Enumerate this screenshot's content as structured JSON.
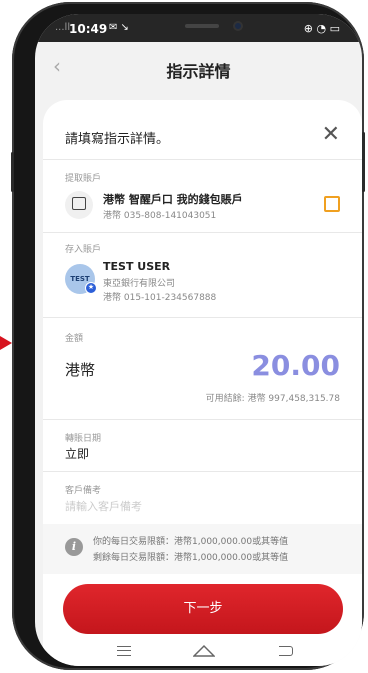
{
  "status_bar": {
    "time": "10:49",
    "left_signal": "...ll"
  },
  "nav": {
    "title": "指示詳情"
  },
  "sheet": {
    "instruction": "請填寫指示詳情。"
  },
  "from_account": {
    "label": "提取賬戶",
    "name": "港幣 智醒戶口 我的錢包賬戶",
    "number": "港幣 035-808-141043051"
  },
  "to_account": {
    "label": "存入賬戶",
    "avatar_text": "TEST",
    "name": "TEST USER",
    "bank": "東亞銀行有限公司",
    "number": "港幣 015-101-234567888"
  },
  "amount": {
    "label": "金額",
    "currency": "港幣",
    "value": "20.00",
    "available": "可用結餘: 港幣 997,458,315.78"
  },
  "transfer_date": {
    "label": "轉賬日期",
    "value": "立即"
  },
  "remark": {
    "label": "客戶備考",
    "placeholder": "請輸入客戶備考"
  },
  "limits": {
    "daily_limit": "你的每日交易限額：港幣1,000,000.00或其等值",
    "remaining_limit": "剩餘每日交易限額：港幣1,000,000.00或其等值"
  },
  "buttons": {
    "next": "下一步"
  },
  "colors": {
    "primary_red": "#d7141f",
    "amount_color": "#8a8ee0",
    "edit_accent": "#f0a020"
  }
}
